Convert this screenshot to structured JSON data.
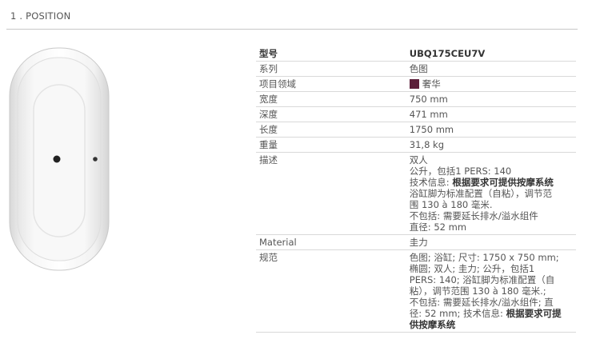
{
  "section": {
    "title": "1 . POSITION"
  },
  "specs": {
    "model_label": "型号",
    "model_value": "UBQ175CEU7V",
    "series_label": "系列",
    "series_value": "色图",
    "project_label": "项目领域",
    "project_value": "奢华",
    "project_color": "#5c1f3a",
    "width_label": "宽度",
    "width_value": "750 mm",
    "depth_label": "深度",
    "depth_value": "471 mm",
    "length_label": "长度",
    "length_value": "1750 mm",
    "weight_label": "重量",
    "weight_value": "31,8 kg",
    "desc_label": "描述",
    "desc": {
      "l1": "双人",
      "l2": "公升，包括1 PERS: 140",
      "l3_prefix": "技术信息: ",
      "l3_bold": "根据要求可提供按摩系统",
      "l4": "浴缸脚为标准配置（自粘），调节范",
      "l5": "围 130 à 180 毫米.",
      "l6": "不包括: 需要延长排水/溢水组件",
      "l7": "直径: 52 mm"
    },
    "material_label": "Material",
    "material_value": "圭力",
    "spec_label": "规范",
    "spec": {
      "l1": "色图; 浴缸; 尺寸: 1750 x 750 mm;",
      "l2": "椭圆; 双人; 圭力; 公升，包括1",
      "l3": "PERS: 140; 浴缸脚为标准配置（自",
      "l4": "粘），调节范围 130 à 180 毫米.;",
      "l5": "不包括: 需要延长排水/溢水组件; 直",
      "l6_prefix": "径: 52 mm; 技术信息: ",
      "l6_bold": "根据要求可提",
      "l7_bold": "供按摩系统"
    }
  }
}
